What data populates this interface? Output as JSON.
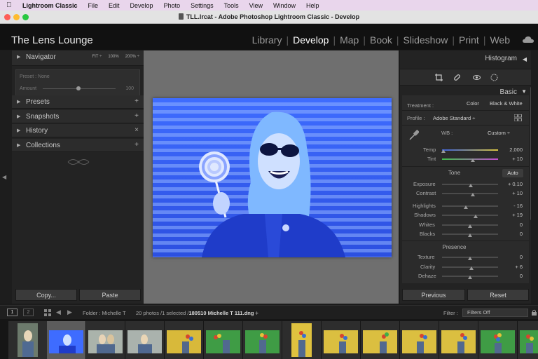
{
  "menubar": {
    "app_name": "Lightroom Classic",
    "items": [
      "File",
      "Edit",
      "Develop",
      "Photo",
      "Settings",
      "Tools",
      "View",
      "Window",
      "Help"
    ]
  },
  "window": {
    "title": "TLL.lrcat - Adobe Photoshop Lightroom Classic - Develop"
  },
  "identity": {
    "name": "The Lens Lounge"
  },
  "modules": [
    "Library",
    "Develop",
    "Map",
    "Book",
    "Slideshow",
    "Print",
    "Web"
  ],
  "active_module": "Develop",
  "left_panel": {
    "navigator": {
      "label": "Navigator",
      "options": [
        "FIT ÷",
        "100%",
        "200% ÷"
      ]
    },
    "preset_box": {
      "preset": "Preset : None",
      "amount_label": "Amount",
      "amount_value": "100"
    },
    "presets": {
      "label": "Presets",
      "action": "+"
    },
    "snapshots": {
      "label": "Snapshots",
      "action": "+"
    },
    "history": {
      "label": "History",
      "action": "×"
    },
    "collections": {
      "label": "Collections",
      "action": "+"
    },
    "copy_button": "Copy...",
    "paste_button": "Paste"
  },
  "right_panel": {
    "histogram_label": "Histogram",
    "basic_label": "Basic",
    "treatment": {
      "label": "Treatment :",
      "color": "Color",
      "bw": "Black & White"
    },
    "profile": {
      "label": "Profile :",
      "value": "Adobe Standard ÷"
    },
    "wb": {
      "label": "WB :",
      "value": "Custom ÷"
    },
    "sliders": {
      "temp": {
        "label": "Temp",
        "value": "2,000",
        "pos": 0.02
      },
      "tint": {
        "label": "Tint",
        "value": "+ 10",
        "pos": 0.55
      }
    },
    "tone": {
      "label": "Tone",
      "auto": "Auto",
      "exposure": {
        "label": "Exposure",
        "value": "+ 0.10",
        "pos": 0.51
      },
      "contrast": {
        "label": "Contrast",
        "value": "+ 10",
        "pos": 0.55
      },
      "highlights": {
        "label": "Highlights",
        "value": "- 16",
        "pos": 0.42
      },
      "shadows": {
        "label": "Shadows",
        "value": "+ 19",
        "pos": 0.6
      },
      "whites": {
        "label": "Whites",
        "value": "0",
        "pos": 0.5
      },
      "blacks": {
        "label": "Blacks",
        "value": "0",
        "pos": 0.5
      }
    },
    "presence": {
      "label": "Presence",
      "texture": {
        "label": "Texture",
        "value": "0",
        "pos": 0.5
      },
      "clarity": {
        "label": "Clarity",
        "value": "+ 6",
        "pos": 0.53
      },
      "dehaze": {
        "label": "Dehaze",
        "value": "0",
        "pos": 0.5
      }
    },
    "previous_button": "Previous",
    "reset_button": "Reset"
  },
  "filmstrip_bar": {
    "monitor1": "1",
    "monitor2": "2",
    "source": "Folder : Michelle T",
    "count": "20 photos /1 selected /",
    "filename": "180510 Michelle T 111.dng ÷",
    "filter_label": "Filter :",
    "filter_value": "Filters Off"
  },
  "colors": {
    "accent_active": "#ffffff",
    "panel_bg": "#232323",
    "canvas_bg": "#6f6f6f",
    "photo_blue": "#2f5bff"
  }
}
